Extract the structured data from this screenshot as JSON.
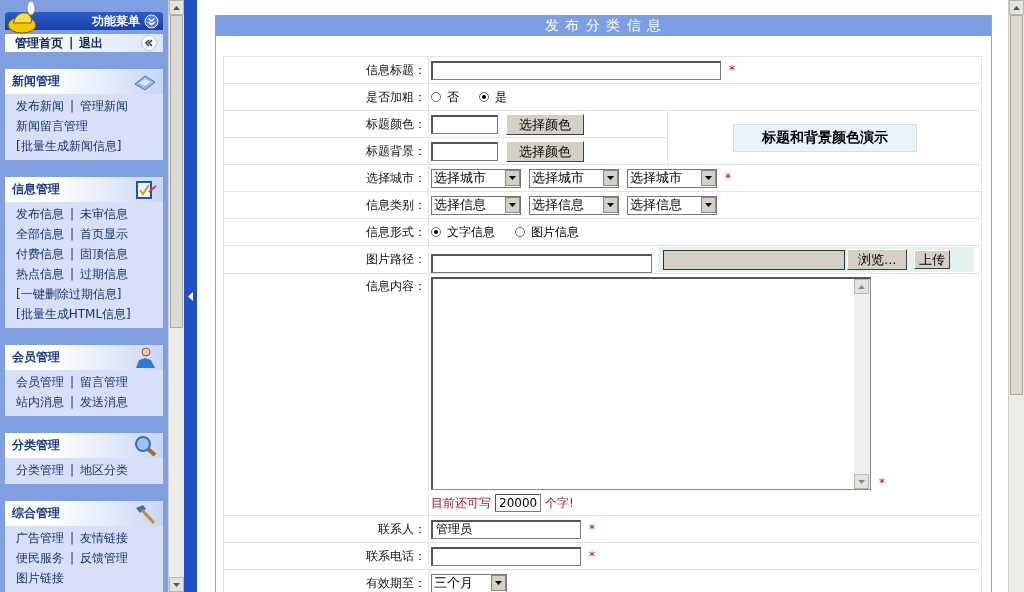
{
  "sidebar": {
    "menu_title": "功能菜单",
    "home_links": [
      "管理首页",
      "|",
      "退出"
    ],
    "sections": [
      {
        "title": "新闻管理",
        "rows": [
          [
            "发布新闻",
            "|",
            "管理新闻"
          ],
          [
            "新闻留言管理"
          ],
          [
            "[批量生成新闻信息]"
          ]
        ]
      },
      {
        "title": "信息管理",
        "rows": [
          [
            "发布信息",
            "|",
            "未审信息"
          ],
          [
            "全部信息",
            "|",
            "首页显示"
          ],
          [
            "付费信息",
            "|",
            "固顶信息"
          ],
          [
            "热点信息",
            "|",
            "过期信息"
          ],
          [
            "[一键删除过期信息]"
          ],
          [
            "[批量生成HTML信息]"
          ]
        ]
      },
      {
        "title": "会员管理",
        "rows": [
          [
            "会员管理",
            "|",
            "留言管理"
          ],
          [
            "站内消息",
            "|",
            "发送消息"
          ]
        ]
      },
      {
        "title": "分类管理",
        "rows": [
          [
            "分类管理",
            "|",
            "地区分类"
          ]
        ]
      },
      {
        "title": "综合管理",
        "rows": [
          [
            "广告管理",
            "|",
            "友情链接"
          ],
          [
            "便民服务",
            "|",
            "反馈管理"
          ],
          [
            "图片链接"
          ]
        ]
      }
    ]
  },
  "main": {
    "title": "发 布 分 类 信 息",
    "preview": "标题和背景颜色演示",
    "rows": [
      {
        "kind": "wide_input",
        "label": "信息标题：",
        "mark": "*"
      },
      {
        "kind": "radio",
        "label": "是否加粗：",
        "options": [
          {
            "text": "否",
            "selected": false
          },
          {
            "text": "是",
            "selected": true
          }
        ]
      },
      {
        "kind": "color",
        "label": "标题颜色：",
        "button": "选择颜色"
      },
      {
        "kind": "color",
        "label": "标题背景：",
        "button": "选择颜色"
      },
      {
        "kind": "selects",
        "label": "选择城市：",
        "selects": [
          "选择城市",
          "选择城市",
          "选择城市"
        ],
        "mark": "*"
      },
      {
        "kind": "selects",
        "label": "信息类别：",
        "selects": [
          "选择信息",
          "选择信息",
          "选择信息"
        ]
      },
      {
        "kind": "radio",
        "label": "信息形式：",
        "options": [
          {
            "text": "文字信息",
            "selected": true
          },
          {
            "text": "图片信息",
            "selected": false
          }
        ]
      },
      {
        "kind": "file",
        "label": "图片路径：",
        "browse": "浏览...",
        "upload": "上传"
      },
      {
        "kind": "textarea",
        "label": "信息内容：",
        "mark": "*",
        "counter_before": "目前还可写",
        "counter_value": "20000",
        "counter_after": "个字!"
      },
      {
        "kind": "input",
        "label": "联系人：",
        "value": "管理员",
        "mark": "*"
      },
      {
        "kind": "input",
        "label": "联系电话：",
        "mark": "*"
      },
      {
        "kind": "dropdown",
        "label": "有效期至：",
        "value": "三个月"
      }
    ]
  }
}
